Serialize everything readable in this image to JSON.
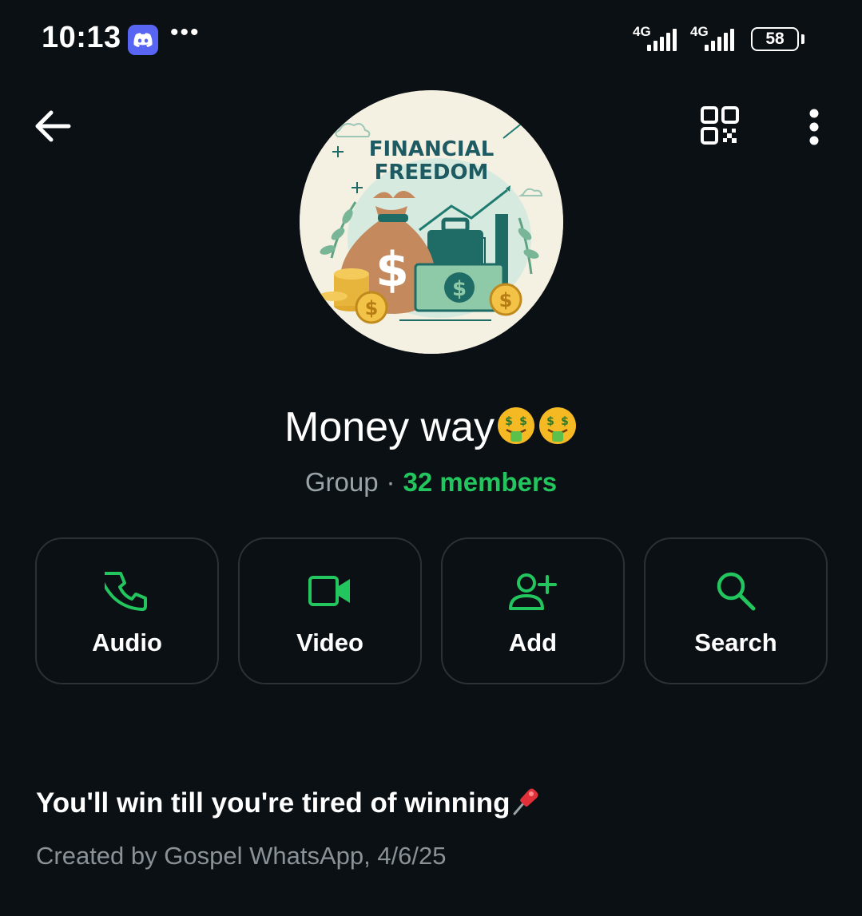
{
  "status_bar": {
    "time": "10:13",
    "network_1": "4G",
    "network_2": "4G",
    "battery": "58",
    "notification_icon": "discord-icon"
  },
  "avatar": {
    "line1": "FINANCIAL",
    "line2": "FREEDOM"
  },
  "group": {
    "name": "Money way",
    "type": "Group",
    "separator": "·",
    "members": "32 members"
  },
  "actions": [
    {
      "label": "Audio",
      "icon": "phone-icon"
    },
    {
      "label": "Video",
      "icon": "video-camera-icon"
    },
    {
      "label": "Add",
      "icon": "add-person-icon"
    },
    {
      "label": "Search",
      "icon": "search-icon"
    }
  ],
  "info": {
    "description": "You'll win till you're tired of winning",
    "created": "Created by Gospel WhatsApp, 4/6/25"
  },
  "colors": {
    "background": "#0b1014",
    "accent": "#22c55e",
    "muted": "#8a9297",
    "border": "#2a3237"
  }
}
